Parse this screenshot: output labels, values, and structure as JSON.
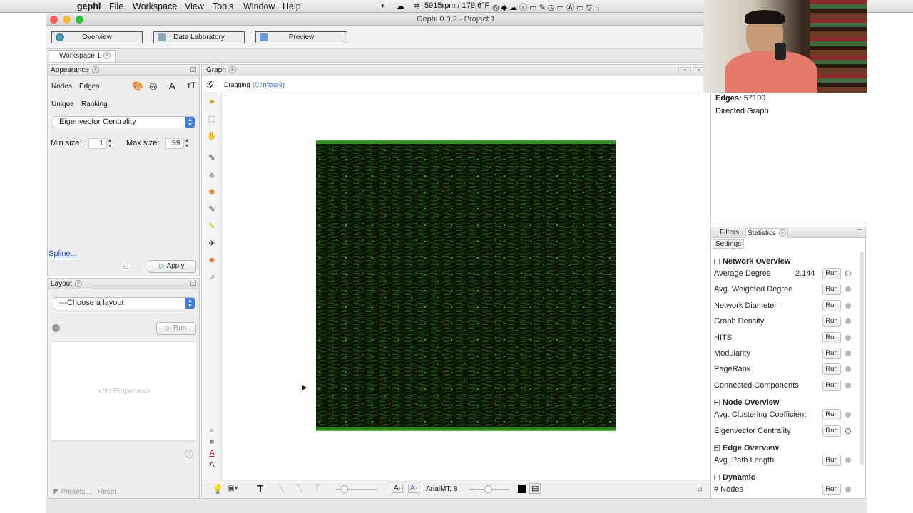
{
  "menubar": {
    "app": "gephi",
    "items": [
      "File",
      "Workspace",
      "View",
      "Tools",
      "Window",
      "Help"
    ],
    "status": "5915rpm / 179.6°F"
  },
  "window": {
    "title": "Gephi 0.9.2 - Project 1"
  },
  "toolbar": {
    "overview": "Overview",
    "data_lab": "Data Laboratory",
    "preview": "Preview"
  },
  "workspace_tab": "Workspace 1",
  "appearance": {
    "title": "Appearance",
    "nodes": "Nodes",
    "edges": "Edges",
    "unique": "Unique",
    "ranking": "Ranking",
    "attribute": "Eigenvector Centrality",
    "min_size_label": "Min size:",
    "min_size": "1",
    "max_size_label": "Max size:",
    "max_size": "99",
    "spline": "Spline...",
    "apply": "Apply"
  },
  "layout": {
    "title": "Layout",
    "choose": "---Choose a layout",
    "run": "Run",
    "no_props": "<No Properties>",
    "presets": "Presets...",
    "reset": "Reset"
  },
  "graph": {
    "tab": "Graph",
    "mode": "Dragging",
    "configure": "(Configure)",
    "font": "ArialMT, 8"
  },
  "graph_info": {
    "edges_label": "Edges:",
    "edges": "57199",
    "type": "Directed Graph"
  },
  "stats_tabs": {
    "filters": "Filters",
    "statistics": "Statistics",
    "settings": "Settings"
  },
  "stats": {
    "run_label": "Run",
    "sections": [
      {
        "title": "Network Overview",
        "rows": [
          {
            "name": "Average Degree",
            "value": "2.144",
            "info": true
          },
          {
            "name": "Avg. Weighted Degree",
            "value": "",
            "info": false
          },
          {
            "name": "Network Diameter",
            "value": "",
            "info": false
          },
          {
            "name": "Graph Density",
            "value": "",
            "info": false
          },
          {
            "name": "HITS",
            "value": "",
            "info": false
          },
          {
            "name": "Modularity",
            "value": "",
            "info": false
          },
          {
            "name": "PageRank",
            "value": "",
            "info": false
          },
          {
            "name": "Connected Components",
            "value": "",
            "info": false
          }
        ]
      },
      {
        "title": "Node Overview",
        "rows": [
          {
            "name": "Avg. Clustering Coefficient",
            "value": "",
            "info": false
          },
          {
            "name": "Eigenvector Centrality",
            "value": "",
            "info": true
          }
        ]
      },
      {
        "title": "Edge Overview",
        "rows": [
          {
            "name": "Avg. Path Length",
            "value": "",
            "info": false
          }
        ]
      },
      {
        "title": "Dynamic",
        "rows": [
          {
            "name": "# Nodes",
            "value": "",
            "info": false
          }
        ]
      }
    ]
  },
  "colors": {
    "graph_fill": "#0a1a05",
    "node_green": "#2f9e1a",
    "accent": "#3b7de8"
  }
}
